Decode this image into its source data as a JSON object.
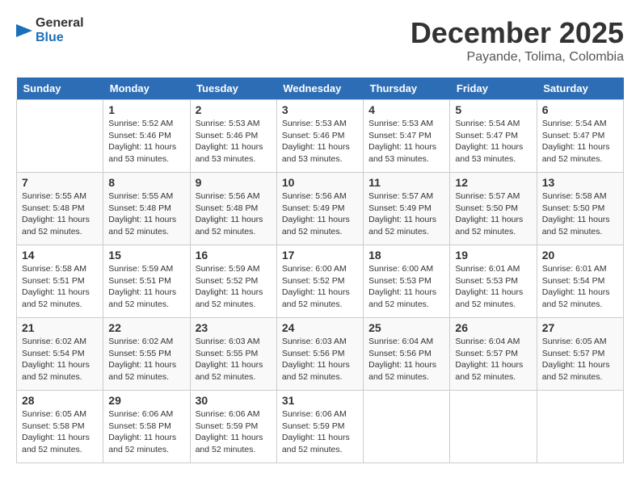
{
  "logo": {
    "line1": "General",
    "line2": "Blue"
  },
  "title": "December 2025",
  "subtitle": "Payande, Tolima, Colombia",
  "days_of_week": [
    "Sunday",
    "Monday",
    "Tuesday",
    "Wednesday",
    "Thursday",
    "Friday",
    "Saturday"
  ],
  "weeks": [
    [
      {
        "day": "",
        "info": ""
      },
      {
        "day": "1",
        "info": "Sunrise: 5:52 AM\nSunset: 5:46 PM\nDaylight: 11 hours\nand 53 minutes."
      },
      {
        "day": "2",
        "info": "Sunrise: 5:53 AM\nSunset: 5:46 PM\nDaylight: 11 hours\nand 53 minutes."
      },
      {
        "day": "3",
        "info": "Sunrise: 5:53 AM\nSunset: 5:46 PM\nDaylight: 11 hours\nand 53 minutes."
      },
      {
        "day": "4",
        "info": "Sunrise: 5:53 AM\nSunset: 5:47 PM\nDaylight: 11 hours\nand 53 minutes."
      },
      {
        "day": "5",
        "info": "Sunrise: 5:54 AM\nSunset: 5:47 PM\nDaylight: 11 hours\nand 53 minutes."
      },
      {
        "day": "6",
        "info": "Sunrise: 5:54 AM\nSunset: 5:47 PM\nDaylight: 11 hours\nand 52 minutes."
      }
    ],
    [
      {
        "day": "7",
        "info": "Sunrise: 5:55 AM\nSunset: 5:48 PM\nDaylight: 11 hours\nand 52 minutes."
      },
      {
        "day": "8",
        "info": "Sunrise: 5:55 AM\nSunset: 5:48 PM\nDaylight: 11 hours\nand 52 minutes."
      },
      {
        "day": "9",
        "info": "Sunrise: 5:56 AM\nSunset: 5:48 PM\nDaylight: 11 hours\nand 52 minutes."
      },
      {
        "day": "10",
        "info": "Sunrise: 5:56 AM\nSunset: 5:49 PM\nDaylight: 11 hours\nand 52 minutes."
      },
      {
        "day": "11",
        "info": "Sunrise: 5:57 AM\nSunset: 5:49 PM\nDaylight: 11 hours\nand 52 minutes."
      },
      {
        "day": "12",
        "info": "Sunrise: 5:57 AM\nSunset: 5:50 PM\nDaylight: 11 hours\nand 52 minutes."
      },
      {
        "day": "13",
        "info": "Sunrise: 5:58 AM\nSunset: 5:50 PM\nDaylight: 11 hours\nand 52 minutes."
      }
    ],
    [
      {
        "day": "14",
        "info": "Sunrise: 5:58 AM\nSunset: 5:51 PM\nDaylight: 11 hours\nand 52 minutes."
      },
      {
        "day": "15",
        "info": "Sunrise: 5:59 AM\nSunset: 5:51 PM\nDaylight: 11 hours\nand 52 minutes."
      },
      {
        "day": "16",
        "info": "Sunrise: 5:59 AM\nSunset: 5:52 PM\nDaylight: 11 hours\nand 52 minutes."
      },
      {
        "day": "17",
        "info": "Sunrise: 6:00 AM\nSunset: 5:52 PM\nDaylight: 11 hours\nand 52 minutes."
      },
      {
        "day": "18",
        "info": "Sunrise: 6:00 AM\nSunset: 5:53 PM\nDaylight: 11 hours\nand 52 minutes."
      },
      {
        "day": "19",
        "info": "Sunrise: 6:01 AM\nSunset: 5:53 PM\nDaylight: 11 hours\nand 52 minutes."
      },
      {
        "day": "20",
        "info": "Sunrise: 6:01 AM\nSunset: 5:54 PM\nDaylight: 11 hours\nand 52 minutes."
      }
    ],
    [
      {
        "day": "21",
        "info": "Sunrise: 6:02 AM\nSunset: 5:54 PM\nDaylight: 11 hours\nand 52 minutes."
      },
      {
        "day": "22",
        "info": "Sunrise: 6:02 AM\nSunset: 5:55 PM\nDaylight: 11 hours\nand 52 minutes."
      },
      {
        "day": "23",
        "info": "Sunrise: 6:03 AM\nSunset: 5:55 PM\nDaylight: 11 hours\nand 52 minutes."
      },
      {
        "day": "24",
        "info": "Sunrise: 6:03 AM\nSunset: 5:56 PM\nDaylight: 11 hours\nand 52 minutes."
      },
      {
        "day": "25",
        "info": "Sunrise: 6:04 AM\nSunset: 5:56 PM\nDaylight: 11 hours\nand 52 minutes."
      },
      {
        "day": "26",
        "info": "Sunrise: 6:04 AM\nSunset: 5:57 PM\nDaylight: 11 hours\nand 52 minutes."
      },
      {
        "day": "27",
        "info": "Sunrise: 6:05 AM\nSunset: 5:57 PM\nDaylight: 11 hours\nand 52 minutes."
      }
    ],
    [
      {
        "day": "28",
        "info": "Sunrise: 6:05 AM\nSunset: 5:58 PM\nDaylight: 11 hours\nand 52 minutes."
      },
      {
        "day": "29",
        "info": "Sunrise: 6:06 AM\nSunset: 5:58 PM\nDaylight: 11 hours\nand 52 minutes."
      },
      {
        "day": "30",
        "info": "Sunrise: 6:06 AM\nSunset: 5:59 PM\nDaylight: 11 hours\nand 52 minutes."
      },
      {
        "day": "31",
        "info": "Sunrise: 6:06 AM\nSunset: 5:59 PM\nDaylight: 11 hours\nand 52 minutes."
      },
      {
        "day": "",
        "info": ""
      },
      {
        "day": "",
        "info": ""
      },
      {
        "day": "",
        "info": ""
      }
    ]
  ]
}
